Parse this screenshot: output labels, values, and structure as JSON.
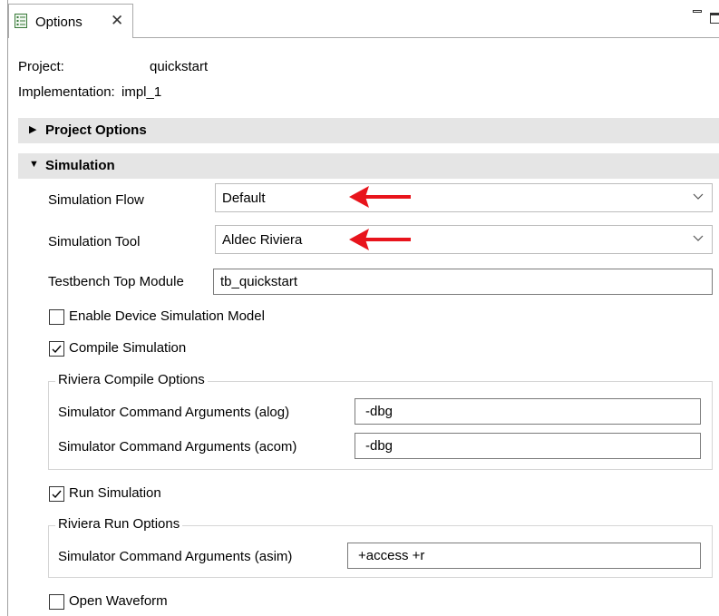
{
  "tab": {
    "label": "Options",
    "close_glyph": "✕"
  },
  "project": {
    "label": "Project:",
    "value": "quickstart"
  },
  "implementation": {
    "label": "Implementation:",
    "value": "impl_1"
  },
  "sections": {
    "project_options": "Project Options",
    "simulation": "Simulation"
  },
  "simulation": {
    "flow_label": "Simulation Flow",
    "flow_value": "Default",
    "tool_label": "Simulation Tool",
    "tool_value": "Aldec Riviera",
    "testbench_label": "Testbench Top Module",
    "testbench_value": "tb_quickstart",
    "enable_device_model": {
      "label": "Enable Device Simulation Model",
      "checked": false
    },
    "compile_simulation": {
      "label": "Compile Simulation",
      "checked": true
    },
    "compile_options": {
      "title": "Riviera Compile Options",
      "alog_label": "Simulator Command Arguments (alog)",
      "alog_value": "-dbg",
      "acom_label": "Simulator Command Arguments (acom)",
      "acom_value": "-dbg"
    },
    "run_simulation": {
      "label": "Run Simulation",
      "checked": true
    },
    "run_options": {
      "title": "Riviera Run Options",
      "asim_label": "Simulator Command Arguments (asim)",
      "asim_value": "+access +r"
    },
    "open_waveform": {
      "label": "Open Waveform",
      "checked": false
    }
  },
  "colors": {
    "annotation_arrow": "#e8141c",
    "section_header_bg": "#e5e5e5"
  }
}
